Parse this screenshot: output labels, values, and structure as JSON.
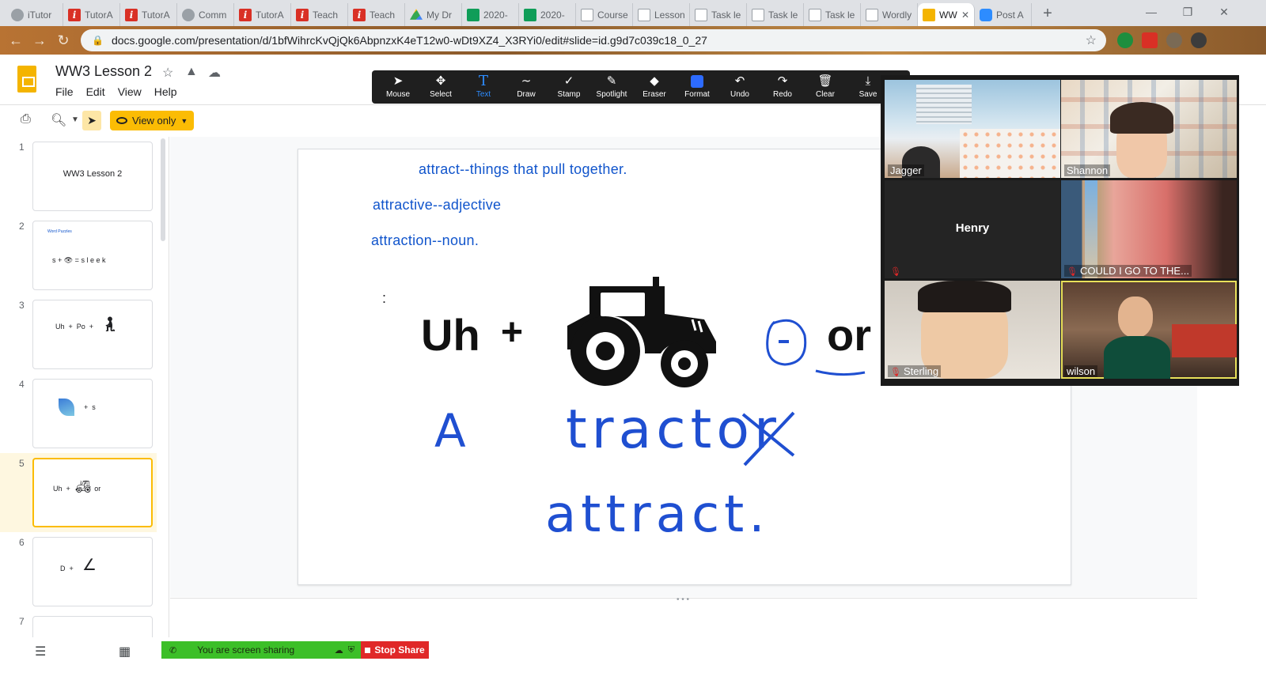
{
  "browser": {
    "tabs": [
      {
        "title": "iTutor",
        "icon": "gray"
      },
      {
        "title": "TutorA",
        "icon": "red"
      },
      {
        "title": "TutorA",
        "icon": "red"
      },
      {
        "title": "Comm",
        "icon": "gray"
      },
      {
        "title": "TutorA",
        "icon": "red"
      },
      {
        "title": "Teach",
        "icon": "red"
      },
      {
        "title": "Teach",
        "icon": "red"
      },
      {
        "title": "My Dr",
        "icon": "drive"
      },
      {
        "title": "2020-",
        "icon": "sheets"
      },
      {
        "title": "2020-",
        "icon": "sheets"
      },
      {
        "title": "Course",
        "icon": "doc"
      },
      {
        "title": "Lesson",
        "icon": "doc"
      },
      {
        "title": "Task le",
        "icon": "doc"
      },
      {
        "title": "Task le",
        "icon": "doc"
      },
      {
        "title": "Task le",
        "icon": "doc"
      },
      {
        "title": "Wordly",
        "icon": "doc"
      },
      {
        "title": "WW",
        "icon": "slides",
        "active": true
      },
      {
        "title": "Post A",
        "icon": "zoom"
      }
    ],
    "url": "docs.google.com/presentation/d/1bfWihrcKvQjQk6AbpnzxK4eT12w0-wDt9XZ4_X3RYi0/edit#slide=id.g9d7c039c18_0_27"
  },
  "slides_app": {
    "doc_title": "WW3 Lesson 2",
    "menu": [
      "File",
      "Edit",
      "View",
      "Help"
    ],
    "view_mode_label": "View only",
    "thumbnails": [
      {
        "num": "1",
        "text": "WW3 Lesson 2"
      },
      {
        "num": "2",
        "text": "Word Puzzles"
      },
      {
        "num": "3",
        "text": "Uh  +  Po  +"
      },
      {
        "num": "4",
        "text": "+  s"
      },
      {
        "num": "5",
        "text": "Uh  +        -   or"
      },
      {
        "num": "6",
        "text": "D  +"
      },
      {
        "num": "7",
        "text": ""
      }
    ],
    "selected_slide": 5
  },
  "slide": {
    "line1": "attract--things that pull together.",
    "line2": "attractive--adjective",
    "line3": "attraction--noun.",
    "colon": ":",
    "uh": "Uh",
    "plus": "+",
    "or": "or",
    "handwriting": [
      "A",
      "tractor",
      "attract."
    ]
  },
  "zoom": {
    "tools": [
      {
        "label": "Mouse",
        "icon": "mouse-icon"
      },
      {
        "label": "Select",
        "icon": "select-icon"
      },
      {
        "label": "Text",
        "icon": "text-icon",
        "active": true
      },
      {
        "label": "Draw",
        "icon": "draw-icon"
      },
      {
        "label": "Stamp",
        "icon": "stamp-icon"
      },
      {
        "label": "Spotlight",
        "icon": "spotlight-icon"
      },
      {
        "label": "Eraser",
        "icon": "eraser-icon"
      },
      {
        "label": "Format",
        "icon": "format-icon"
      },
      {
        "label": "Undo",
        "icon": "undo-icon"
      },
      {
        "label": "Redo",
        "icon": "redo-icon"
      },
      {
        "label": "Clear",
        "icon": "clear-icon"
      },
      {
        "label": "Save",
        "icon": "save-icon"
      }
    ],
    "participants": [
      {
        "name": "Jagger",
        "muted": false
      },
      {
        "name": "Shannon",
        "muted": false
      },
      {
        "name": "Henry",
        "muted": true
      },
      {
        "name": "COULD I GO TO THE...",
        "muted": true
      },
      {
        "name": "Sterling",
        "muted": true
      },
      {
        "name": "wilson",
        "muted": false,
        "speaking": true
      }
    ],
    "sharing_label": "You are screen sharing",
    "stop_share_label": "Stop Share"
  },
  "colors": {
    "slide_text": "#1155cc",
    "ink": "#1f4fd1",
    "view_only": "#fbbc04",
    "share_green": "#3cbf28",
    "stop_red": "#e02828"
  }
}
